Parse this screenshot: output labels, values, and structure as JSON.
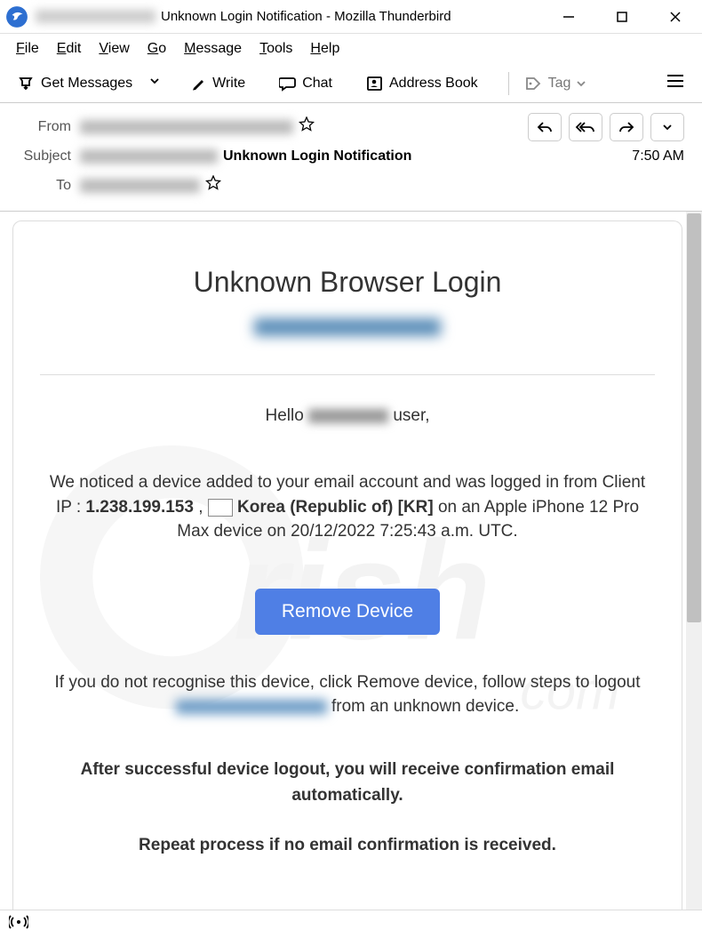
{
  "titlebar": {
    "title": "Unknown Login Notification - Mozilla Thunderbird"
  },
  "menubar": {
    "file": "File",
    "edit": "Edit",
    "view": "View",
    "go": "Go",
    "message": "Message",
    "tools": "Tools",
    "help": "Help"
  },
  "toolbar": {
    "get_messages": "Get Messages",
    "write": "Write",
    "chat": "Chat",
    "address_book": "Address Book",
    "tag": "Tag"
  },
  "header": {
    "from_label": "From",
    "subject_label": "Subject",
    "subject_value": "Unknown Login Notification",
    "to_label": "To",
    "time": "7:50 AM"
  },
  "email": {
    "title": "Unknown Browser Login",
    "hello_prefix": "Hello ",
    "hello_suffix": " user,",
    "body1_a": "We noticed a device added to your email account and was logged in from Client IP : ",
    "body1_ip": "1.238.199.153",
    "body1_sep": "  ,  ",
    "body1_country": " Korea (Republic of) [KR]",
    "body1_b": " on an Apple iPhone 12 Pro Max device on 20/12/2022 7:25:43 a.m. UTC.",
    "remove_btn": "Remove Device",
    "body2_a": "If you do not recognise this device, click Remove device, follow steps to logout  ",
    "body2_b": "  from an unknown device.",
    "bold1": "After successful device logout, you will receive confirmation email automatically.",
    "bold2": "Repeat process if no email confirmation is received."
  }
}
